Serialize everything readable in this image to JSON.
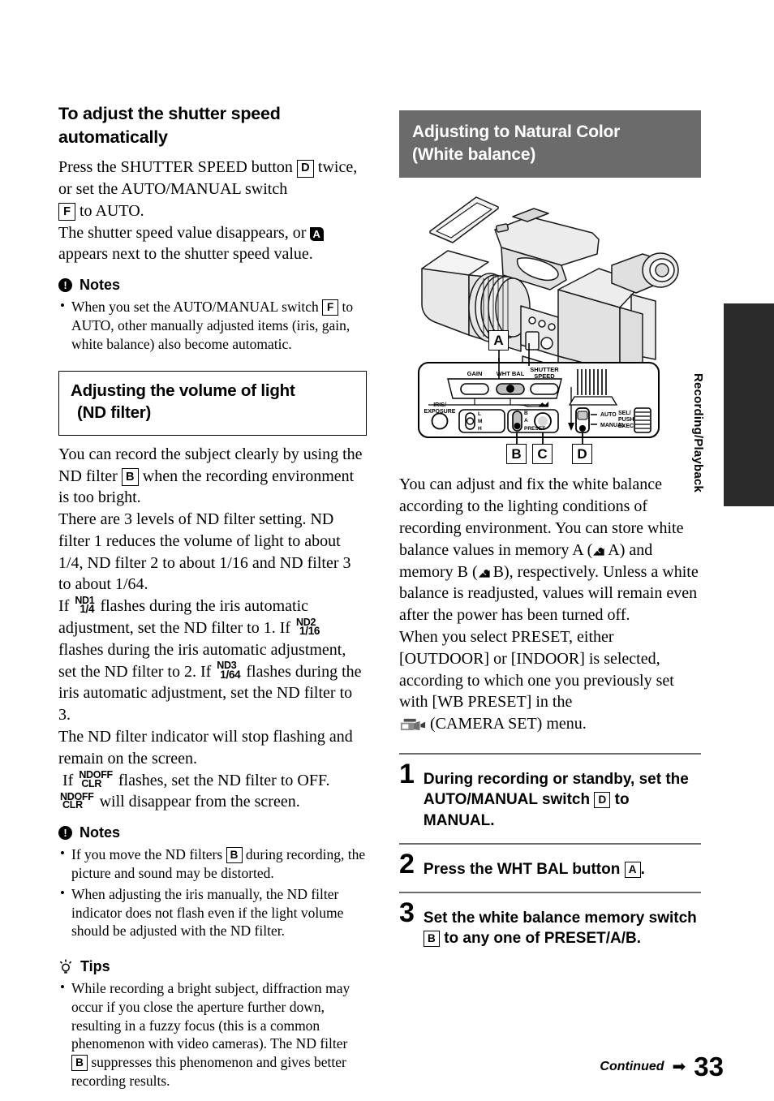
{
  "page": {
    "number": "33",
    "continued_label": "Continued",
    "continued_arrow": "➡",
    "side_tab_label": "Recording/Playback"
  },
  "left_column": {
    "heading_1": "To adjust the shutter speed automatically",
    "heading_1_line1": "To adjust the shutter speed",
    "heading_1_line2": "automatically",
    "intro": {
      "l1a": "Press the SHUTTER SPEED button",
      "key_d": "D",
      "l1b": "twice, or set the AUTO/MANUAL switch",
      "key_f": "F",
      "l1c": "to AUTO.",
      "l2a": "The shutter speed value disappears, or",
      "auto_marker": "A",
      "l2b": "appears next to the shutter speed value."
    },
    "notes_1": {
      "title": "Notes",
      "items": [
        {
          "a": "When you set the AUTO/MANUAL switch",
          "key": "F",
          "b": "to AUTO, other manually adjusted items (iris, gain, white balance) also become automatic."
        }
      ]
    },
    "heading_2_line1": "Adjusting the volume of light",
    "heading_2_line2": "(ND filter)",
    "nd_body": {
      "p1a": "You can record the subject clearly by using the ND filter",
      "key_b": "B",
      "p1b": "when the recording environment is too bright.",
      "p2": "There are 3 levels of ND filter setting. ND filter 1 reduces the volume of light to about 1/4, ND filter 2 to about 1/16 and ND filter 3 to about 1/64.",
      "p3a": "If",
      "icon_nd1_top": "ND1",
      "icon_nd1_bottom": "1/4",
      "p3b": "flashes during the iris automatic adjustment, set the ND filter to 1. If",
      "icon_nd2_top": "ND2",
      "icon_nd2_bottom": "1/16",
      "p3c": "flashes during the iris automatic adjustment, set the ND filter to 2. If",
      "icon_nd3_top": "ND3",
      "icon_nd3_bottom": "1/64",
      "p3d": "flashes during the iris automatic adjustment, set the ND filter to 3.",
      "p4": "The ND filter indicator will stop flashing and remain on the screen.",
      "p5a": "If",
      "icon_ndoff_top": "NDOFF",
      "icon_ndoff_bottom": "CLR",
      "p5b": "flashes, set the ND filter to OFF.",
      "p5c": "will disappear from the screen."
    },
    "notes_2": {
      "title": "Notes",
      "items": [
        {
          "a": "If you move the ND filters",
          "key": "B",
          "b": "during recording, the picture and sound may be distorted."
        },
        {
          "a": "When adjusting the iris manually, the ND filter indicator does not flash even if the light volume should be adjusted with the ND filter.",
          "key": "",
          "b": ""
        }
      ]
    },
    "tips": {
      "title": "Tips",
      "items": [
        {
          "a": "While recording a bright subject, diffraction may occur if you close the aperture further down, resulting in a fuzzy focus (this is a common phenomenon with video cameras). The ND filter",
          "key": "B",
          "b": "suppresses this phenomenon and gives better recording results."
        }
      ]
    }
  },
  "right_column": {
    "heading_line1": "Adjusting to Natural Color",
    "heading_line2": "(White balance)",
    "heading_bg": "#6b6b6b",
    "illustration": {
      "callouts": [
        "A",
        "B",
        "C",
        "D"
      ],
      "panel_labels": {
        "gain": "GAIN",
        "wht_bal": "WHT BAL",
        "shutter_speed_l1": "SHUTTER",
        "shutter_speed_l2": "SPEED",
        "iris_l1": "IRIS/",
        "iris_l2": "EXPOSURE",
        "gain_steps": [
          "L",
          "M",
          "H"
        ],
        "wb_steps": [
          "B",
          "A",
          "PRESET"
        ],
        "auto": "AUTO",
        "manual": "MANUAL",
        "sel_push_exec_l1": "SEL/",
        "sel_push_exec_l2": "PUSH",
        "sel_push_exec_l3": "EXEC"
      }
    },
    "body": {
      "p1a": "You can adjust and fix the white balance according to the lighting conditions of recording environment. You can store white balance values in memory A (",
      "mem_a": "A",
      "p1b": ") and memory B (",
      "mem_b": "B",
      "p1c": "), respectively. Unless a white balance is readjusted, values will remain even after the power has been turned off.",
      "p2a": "When you select PRESET, either [OUTDOOR] or [INDOOR] is selected, according to which one you previously set with [WB PRESET] in the",
      "p2b": "(CAMERA SET) menu."
    },
    "steps": [
      {
        "number": "1",
        "a": "During recording or standby, set the AUTO/MANUAL switch",
        "key": "D",
        "b": "to MANUAL."
      },
      {
        "number": "2",
        "a": "Press the WHT BAL button",
        "key": "A",
        "b": "."
      },
      {
        "number": "3",
        "a": "Set the white balance memory switch",
        "key": "B",
        "b": "to any one of PRESET/A/B."
      }
    ]
  }
}
